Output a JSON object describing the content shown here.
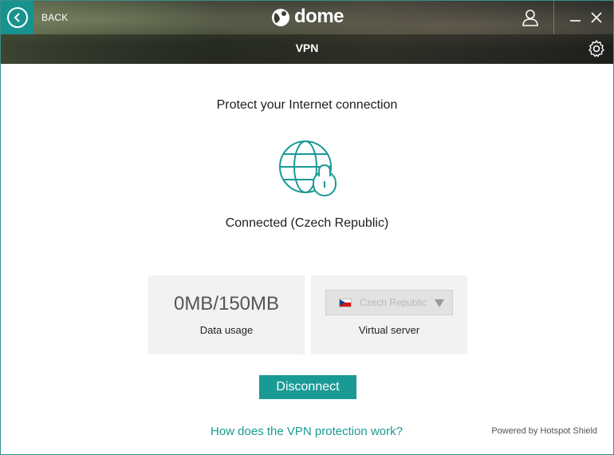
{
  "titlebar": {
    "back_label": "BACK",
    "logo_text": "dome",
    "icons": [
      "back-arrow-icon",
      "user-icon",
      "minimize-icon",
      "close-icon"
    ]
  },
  "subbar": {
    "title": "VPN",
    "icons": [
      "gear-icon"
    ]
  },
  "main": {
    "headline": "Protect your Internet connection",
    "status_icon": "globe-lock-icon",
    "status": "Connected (Czech Republic)",
    "data_usage": {
      "value": "0MB/150MB",
      "label": "Data usage"
    },
    "virtual_server": {
      "selected": "Czech Republic",
      "label": "Virtual server"
    },
    "disconnect_label": "Disconnect",
    "help_link": "How does the VPN protection work?",
    "powered_by": "Powered by Hotspot Shield"
  },
  "colors": {
    "accent": "#1a9a95",
    "back_button": "#18928e",
    "card_bg": "#f2f2f2"
  }
}
